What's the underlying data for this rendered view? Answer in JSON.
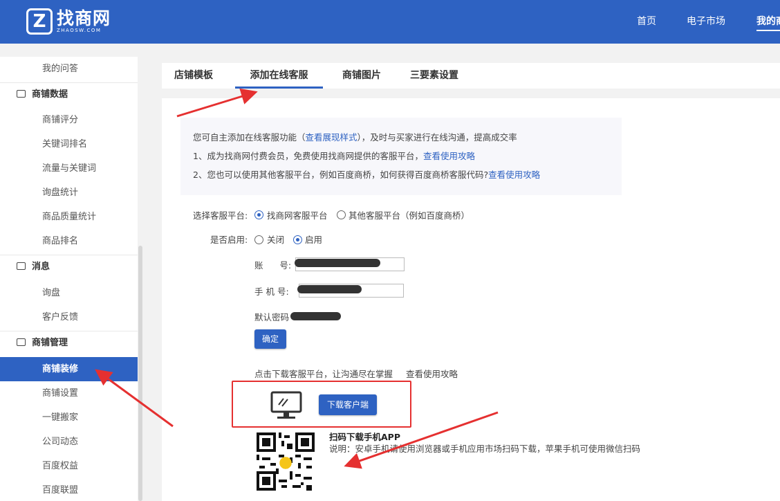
{
  "header": {
    "logo_name": "找商网",
    "logo_sub": "ZHAOSW.COM",
    "nav": {
      "home": "首页",
      "market": "电子市场",
      "mine": "我的商"
    }
  },
  "sidebar": {
    "top_item": "我的问答",
    "sections": [
      {
        "title": "商铺数据",
        "icon": "chart-icon",
        "items": [
          "商铺评分",
          "关键词排名",
          "流量与关键词",
          "询盘统计",
          "商品质量统计",
          "商品排名"
        ]
      },
      {
        "title": "消息",
        "icon": "mail-icon",
        "items": [
          "询盘",
          "客户反馈"
        ]
      },
      {
        "title": "商铺管理",
        "icon": "store-icon",
        "items": [
          "商铺装修",
          "商铺设置",
          "一键搬家",
          "公司动态",
          "百度权益",
          "百度联盟"
        ]
      }
    ],
    "active_item": "商铺装修"
  },
  "tabs": [
    "店铺模板",
    "添加在线客服",
    "商铺图片",
    "三要素设置"
  ],
  "active_tab": "添加在线客服",
  "info": {
    "line1_pre": "您可自主添加在线客服功能（",
    "line1_link": "查看展现样式",
    "line1_post": "），及时与买家进行在线沟通，提高成交率",
    "line2_pre": "1、成为找商网付费会员，免费使用找商网提供的客服平台，",
    "line2_link": "查看使用攻略",
    "line3_pre": "2、您也可以使用其他客服平台，例如百度商桥，如何获得百度商桥客服代码?",
    "line3_link": "查看使用攻略"
  },
  "form": {
    "platform_label": "选择客服平台:",
    "platform_opt1": "找商网客服平台",
    "platform_opt2": "其他客服平台（例如百度商桥）",
    "platform_selected": "找商网客服平台",
    "enable_label": "是否启用:",
    "enable_off": "关闭",
    "enable_on": "启用",
    "enable_selected": "启用",
    "account_label": "账      号:",
    "phone_label": "手 机 号:",
    "password_label": "默认密码",
    "confirm_button": "确定"
  },
  "download": {
    "text": "点击下载客服平台，让沟通尽在掌握",
    "link": "查看使用攻略",
    "button": "下载客户端"
  },
  "app": {
    "title": "扫码下载手机APP",
    "desc": "说明：安卓手机请使用浏览器或手机应用市场扫码下载，苹果手机可使用微信扫码"
  },
  "colors": {
    "brand": "#2e62c2",
    "annotation": "#e53030"
  }
}
